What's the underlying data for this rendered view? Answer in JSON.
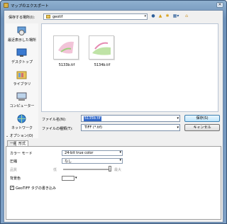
{
  "window": {
    "title": "マップのエクスポート",
    "close_glyph": "✕"
  },
  "nav": {
    "save_in_label": "保存する場所(I):",
    "save_in_value": "geotif",
    "toolbar_icons": [
      "back-icon",
      "up-folder-icon",
      "new-folder-icon",
      "views-icon",
      "tools-icon"
    ]
  },
  "places": [
    {
      "name": "recent",
      "label": "最近表示した場所",
      "icon": "recent-places-icon"
    },
    {
      "name": "desktop",
      "label": "デスクトップ",
      "icon": "desktop-icon"
    },
    {
      "name": "libraries",
      "label": "ライブラリ",
      "icon": "libraries-icon"
    },
    {
      "name": "computer",
      "label": "コンピューター",
      "icon": "computer-icon"
    },
    {
      "name": "network",
      "label": "ネットワーク",
      "icon": "network-icon"
    }
  ],
  "files": [
    {
      "name": "5133b.tif"
    },
    {
      "name": "5134b.tif"
    }
  ],
  "form": {
    "filename_label": "ファイル名(N):",
    "filename_value": "5135b.tif",
    "filetype_label": "ファイルの種類(T):",
    "filetype_value": "TIFF (*.tif)",
    "save_label": "保存(S)",
    "cancel_label": "キャンセル"
  },
  "options": {
    "header": "オプション(O)",
    "tabs": [
      "一般",
      "形式"
    ],
    "color_mode_label": "カラー モード",
    "color_mode_value": "24-bit true color",
    "compression_label": "圧縮",
    "compression_value": "なし",
    "quality_label": "品質",
    "quality_low": "低",
    "quality_high": "最大",
    "quality_level": 1.0,
    "bg_color_label": "背景色",
    "bg_color_value": "#ffffff",
    "geotiff_label": "GeoTIFF タグの書き込み",
    "geotiff_checked": true
  }
}
